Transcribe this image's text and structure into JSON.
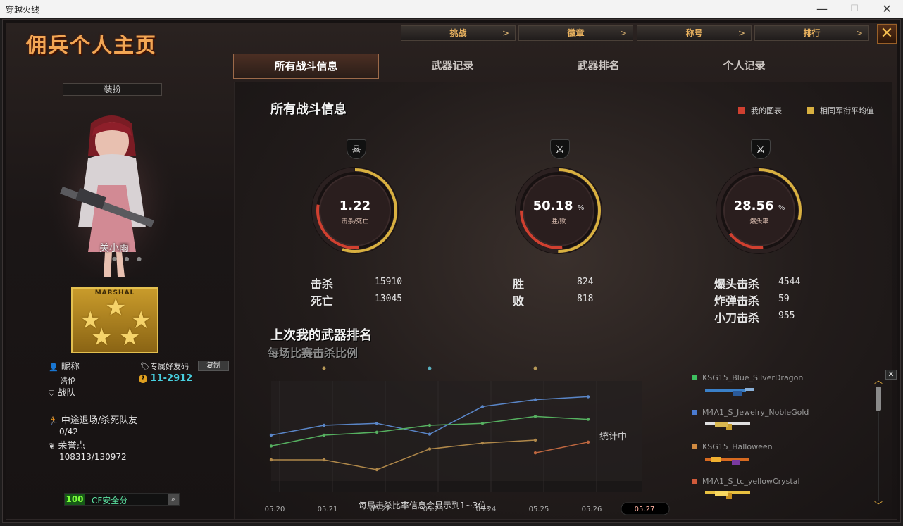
{
  "window": {
    "title": "穿越火线",
    "minimize": "—",
    "maximize": "☐",
    "close": "✕"
  },
  "logo": "佣兵个人主页",
  "top_tabs": [
    {
      "label": "挑战",
      "arrow": ">"
    },
    {
      "label": "徽章",
      "arrow": ">"
    },
    {
      "label": "称号",
      "arrow": ">"
    },
    {
      "label": "排行",
      "arrow": ">"
    }
  ],
  "close_label": "✕",
  "nav_tabs": [
    "所有战斗信息",
    "武器记录",
    "武器排名",
    "个人记录"
  ],
  "left": {
    "dress_label": "装扮",
    "char_name": "关小雨",
    "rank_label": "MARSHAL",
    "nickname_label": "昵称",
    "nickname_value": "诰伦",
    "friend_code_label": "专属好友码",
    "copy_label": "复制",
    "friend_code_value": "11-2912",
    "team_label": "战队",
    "quit_label": "中途退场/杀死队友",
    "quit_value": "0/42",
    "honor_label": "荣誉点",
    "honor_value": "108313/130972",
    "safe_score": "100",
    "safe_label": "CF安全分"
  },
  "main": {
    "title": "所有战斗信息",
    "legend_mine": "我的图表",
    "legend_avg": "相同军衔平均值",
    "colors": {
      "mine": "#d04030",
      "avg": "#d8b040"
    },
    "gauges": [
      {
        "value": "1.22",
        "unit": "",
        "label": "击杀/死亡",
        "icon": "skull-icon",
        "fill": 0.55
      },
      {
        "value": "50.18",
        "unit": "%",
        "label": "胜/败",
        "icon": "crossed-swords-icon",
        "fill": 0.5018
      },
      {
        "value": "28.56",
        "unit": "%",
        "label": "爆头率",
        "icon": "rifle-icon",
        "fill": 0.2856
      }
    ],
    "stats_kd": [
      {
        "label": "击杀",
        "value": "15910"
      },
      {
        "label": "死亡",
        "value": "13045"
      }
    ],
    "stats_wl": [
      {
        "label": "胜",
        "value": "824"
      },
      {
        "label": "败",
        "value": "818"
      }
    ],
    "stats_hs": [
      {
        "label": "爆头击杀",
        "value": "4544"
      },
      {
        "label": "炸弹击杀",
        "value": "59"
      },
      {
        "label": "小刀击杀",
        "value": "955"
      }
    ],
    "weapon_rank_title": "上次我的武器排名",
    "chart_title": "每场比赛击杀比例",
    "chart_status": "统计中",
    "chart_note": "每局击杀比率信息会显示到1~3位。",
    "weapons": [
      {
        "name": "KSG15_Blue_SilverDragon",
        "color": "#3ec060"
      },
      {
        "name": "M4A1_S_Jewelry_NobleGold",
        "color": "#4a7ad0"
      },
      {
        "name": "KSG15_Halloween",
        "color": "#d08a40"
      },
      {
        "name": "M4A1_S_tc_yellowCrystal",
        "color": "#d05a3a"
      }
    ]
  },
  "chart_data": {
    "type": "line",
    "categories": [
      "05.20",
      "05.21",
      "05.22",
      "05.23",
      "05.24",
      "05.25",
      "05.26",
      "05.27"
    ],
    "highlight": "05.27",
    "series": [
      {
        "color": "#5a86c8",
        "values": [
          0.45,
          0.55,
          0.57,
          0.46,
          0.74,
          0.81,
          0.84,
          null
        ]
      },
      {
        "color": "#56b060",
        "values": [
          0.34,
          0.45,
          0.48,
          0.55,
          0.57,
          0.64,
          0.61,
          null
        ]
      },
      {
        "color": "#b0884a",
        "values": [
          0.2,
          0.2,
          0.1,
          0.31,
          0.37,
          0.4,
          null,
          null
        ]
      },
      {
        "color": "#c06840",
        "values": [
          null,
          null,
          null,
          null,
          null,
          0.27,
          0.38,
          null
        ]
      }
    ],
    "top_markers": [
      {
        "x": "05.21",
        "color": "#b89a58"
      },
      {
        "x": "05.23",
        "color": "#5ab0c0"
      },
      {
        "x": "05.25",
        "color": "#b89a58"
      }
    ]
  }
}
